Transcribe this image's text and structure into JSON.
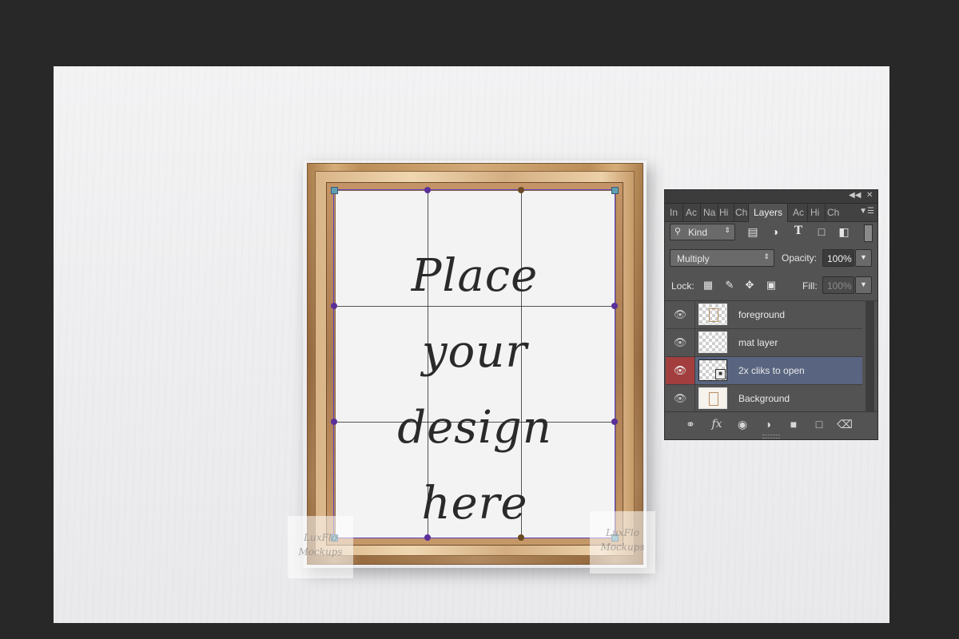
{
  "artwork": {
    "placeholder_lines": [
      "Place",
      "your",
      "design",
      "here"
    ],
    "watermark_left": "LuxFlo Mockups",
    "watermark_right": "LuxFlo Mockups"
  },
  "layers_panel": {
    "collapse_icon": "double-chevron-left-icon",
    "close_label": "✕",
    "tabs": [
      {
        "label": "In"
      },
      {
        "label": "Ac"
      },
      {
        "label": "Na"
      },
      {
        "label": "Hi"
      },
      {
        "label": "Ch"
      },
      {
        "label": "Layers",
        "active": true
      },
      {
        "label": "Ac"
      },
      {
        "label": "Hi"
      },
      {
        "label": "Ch"
      }
    ],
    "filter": {
      "kind_label": "Kind"
    },
    "blend_mode": "Multiply",
    "opacity_label": "Opacity:",
    "opacity_value": "100%",
    "lock_label": "Lock:",
    "fill_label": "Fill:",
    "fill_value": "100%",
    "layers": [
      {
        "name": "foreground",
        "visible": true,
        "selected": false
      },
      {
        "name": "mat layer",
        "visible": true,
        "selected": false
      },
      {
        "name": "2x cliks to open",
        "visible": true,
        "selected": true
      },
      {
        "name": "Background",
        "visible": true,
        "selected": false
      }
    ],
    "bottom_icons": [
      "link-icon",
      "fx-icon",
      "mask-icon",
      "adjustment-icon",
      "folder-icon",
      "new-layer-icon",
      "trash-icon"
    ],
    "fx_label": "fx"
  },
  "colors": {
    "workspace": "#282828",
    "panel_bg": "#535353",
    "selected_layer": "#596580",
    "visibility_highlight": "#a23e3e",
    "transform_box": "#5b3fbf"
  }
}
